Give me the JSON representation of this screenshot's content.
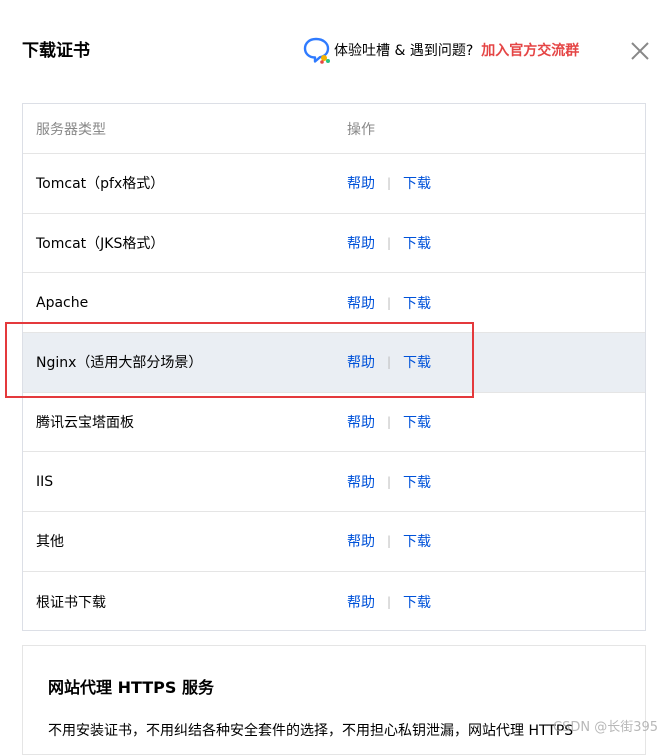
{
  "dialog": {
    "title": "下载证书",
    "feedback_text": "体验吐槽 & 遇到问题?",
    "feedback_link": "加入官方交流群"
  },
  "table": {
    "headers": [
      "服务器类型",
      "操作"
    ],
    "help_label": "帮助",
    "separator": "|",
    "download_label": "下载",
    "rows": [
      {
        "name": "Tomcat（pfx格式）"
      },
      {
        "name": "Tomcat（JKS格式）"
      },
      {
        "name": "Apache"
      },
      {
        "name": "Nginx（适用大部分场景）",
        "highlighted": true
      },
      {
        "name": "腾讯云宝塔面板"
      },
      {
        "name": "IIS"
      },
      {
        "name": "其他"
      },
      {
        "name": "根证书下载"
      }
    ]
  },
  "promo": {
    "title": "网站代理 HTTPS 服务",
    "description": "不用安装证书，不用纠结各种安全套件的选择，不用担心私钥泄漏，网站代理 HTTPS"
  },
  "watermark": "CSDN @长街395",
  "colors": {
    "accent_link": "#0052d9",
    "feedback_link": "#e54545",
    "highlight_row": "#eaeef3",
    "annotation_box": "#e4393c"
  }
}
